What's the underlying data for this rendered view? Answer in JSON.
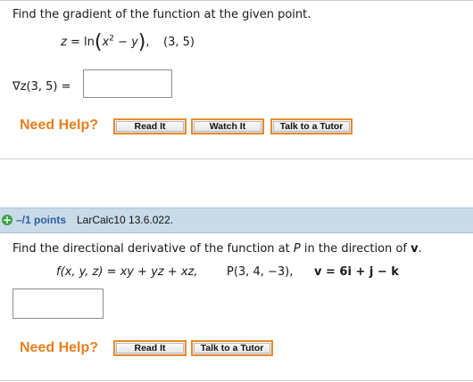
{
  "q1": {
    "prompt": "Find the gradient of the function at the given point.",
    "func_lhs": "z",
    "equals": "=",
    "ln": "ln",
    "x": "x",
    "exp": "2",
    "minus": "−",
    "y": "y",
    "point": "(3, 5)",
    "answer_label": "∇z(3, 5)  =",
    "answer_value": "",
    "need_help": "Need Help?",
    "buttons": {
      "read": "Read It",
      "watch": "Watch It",
      "tutor": "Talk to a Tutor"
    }
  },
  "q2": {
    "points_label": "–/1 points",
    "question_id": "LarCalc10 13.6.022.",
    "prompt_start": "Find the directional derivative of the function at ",
    "prompt_P": "P",
    "prompt_mid": " in the direction of ",
    "prompt_v": "v",
    "prompt_end": ".",
    "func": "f(x, y, z)  =  xy + yz + xz,",
    "point": "P(3, 4, −3),",
    "vector": "v  =  6i + j − k",
    "answer_value": "",
    "need_help": "Need Help?",
    "buttons": {
      "read": "Read It",
      "tutor": "Talk to a Tutor"
    }
  },
  "colors": {
    "accent": "#e87e1c",
    "header_bg": "#c9dbe9",
    "points": "#2b5f9e",
    "plus": "#3aa241"
  }
}
